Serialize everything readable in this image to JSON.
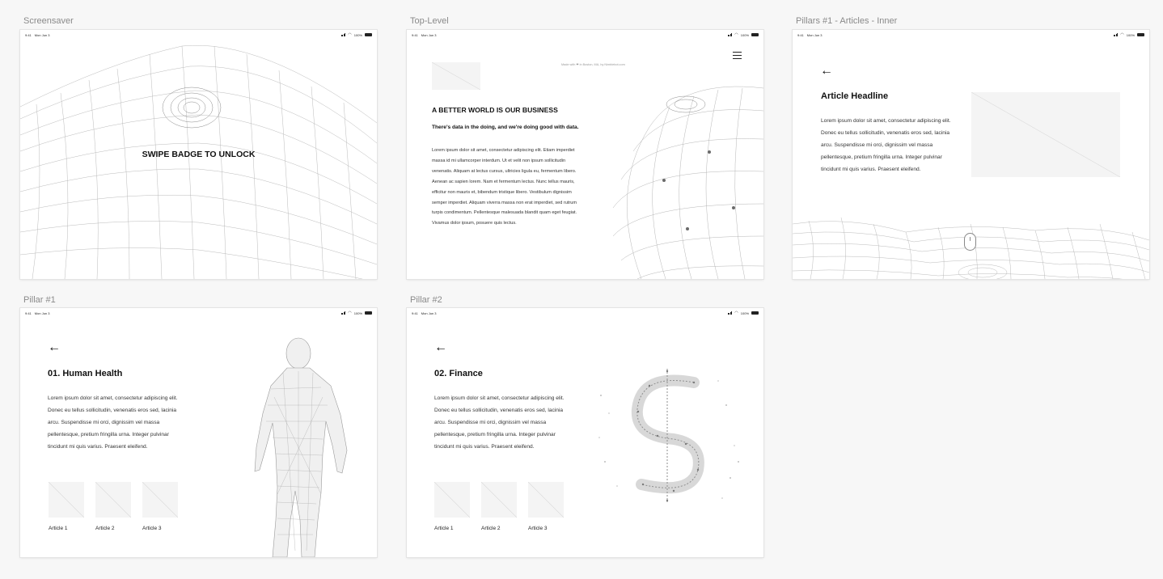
{
  "artboards": {
    "screensaver": {
      "label": "Screensaver",
      "unlock_text": "SWIPE BADGE TO UNLOCK"
    },
    "top_level": {
      "label": "Top-Level",
      "credit": "Made with ❤ in Boston, MA, by Nimblebot.com",
      "headline": "A BETTER WORLD IS OUR BUSINESS",
      "subhead": "There's data in the doing, and we're doing good with data.",
      "body": "Lorem ipsum dolor sit amet, consectetur adipiscing elit. Etiam imperdiet massa id mi ullamcorper interdum. Ut et velit non ipsum sollicitudin venenatis. Aliquam at lectus cursus, ultricies ligula eu, fermentum libero. Aenean ac sapien lorem. Nam et fermentum lectus. Nunc tellus mauris, efficitur non mauris et, bibendum tristique libero. Vestibulum dignissim semper imperdiet. Aliquam viverra massa non erat imperdiet, sed rutrum turpis condimentum. Pellentesque malesuada blandit quam eget feugiat. Vivamus dolor ipsum, posuere quis lectus."
    },
    "articles_inner": {
      "label": "Pillars #1 - Articles - Inner",
      "headline": "Article Headline",
      "body": "Lorem ipsum dolor sit amet, consectetur adipiscing elit. Donec eu tellus sollicitudin, venenatis eros sed, lacinia arcu. Suspendisse mi orci, dignissim vel massa pellentesque, pretium fringilla urna. Integer pulvinar tincidunt mi quis varius. Praesent eleifend."
    },
    "pillar1": {
      "label": "Pillar #1",
      "headline": "01. Human Health",
      "body": "Lorem ipsum dolor sit amet, consectetur adipiscing elit. Donec eu tellus sollicitudin, venenatis eros sed, lacinia arcu. Suspendisse mi orci, dignissim vel massa pellentesque, pretium fringilla urna. Integer pulvinar tincidunt mi quis varius. Praesent eleifend.",
      "articles": [
        "Article 1",
        "Article 2",
        "Article 3"
      ]
    },
    "pillar2": {
      "label": "Pillar #2",
      "headline": "02. Finance",
      "body": "Lorem ipsum dolor sit amet, consectetur adipiscing elit. Donec eu tellus sollicitudin, venenatis eros sed, lacinia arcu. Suspendisse mi orci, dignissim vel massa pellentesque, pretium fringilla urna. Integer pulvinar tincidunt mi quis varius. Praesent eleifend.",
      "articles": [
        "Article 1",
        "Article 2",
        "Article 3"
      ]
    }
  },
  "status_bar": {
    "time": "9:41",
    "date": "Mon Jun 3",
    "battery": "100%"
  },
  "icons": {
    "back": "←"
  },
  "colors": {
    "canvas": "#f7f7f7",
    "frame": "#ffffff",
    "label": "#8a8a8a",
    "text": "#111111"
  }
}
